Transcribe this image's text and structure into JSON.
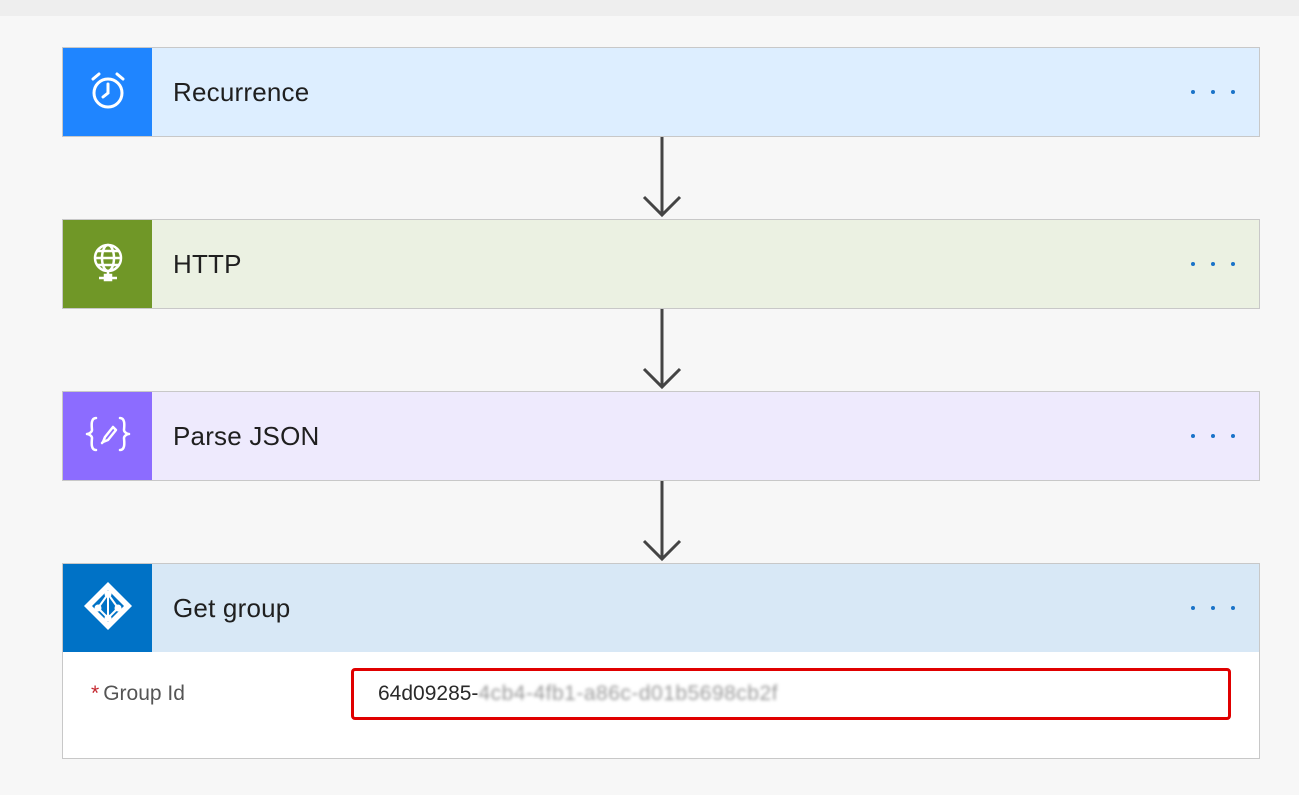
{
  "steps": [
    {
      "title": "Recurrence",
      "icon": "alarm-clock-icon",
      "accent": "#1f85ff",
      "header_bg": "#ddeeff"
    },
    {
      "title": "HTTP",
      "icon": "globe-icon",
      "accent": "#709727",
      "header_bg": "#ebf1e2"
    },
    {
      "title": "Parse JSON",
      "icon": "json-braces-icon",
      "accent": "#8c6cff",
      "header_bg": "#eeeafd"
    },
    {
      "title": "Get group",
      "icon": "azure-ad-icon",
      "accent": "#0072c6",
      "header_bg": "#d8e8f6"
    }
  ],
  "get_group": {
    "field_required_mark": "*",
    "field_label": "Group Id",
    "value_visible": "64d09285-",
    "value_obscured": "4cb4-4fb1-a86c-d01b5698cb2f"
  },
  "more_menu_label": "More options"
}
